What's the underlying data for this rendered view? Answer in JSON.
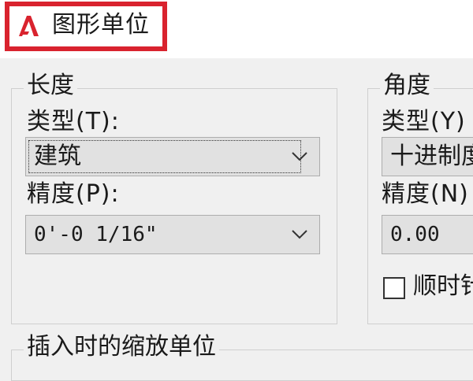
{
  "window": {
    "title": "图形单位",
    "icon": "autocad-logo-icon",
    "highlight_color": "#d9232e"
  },
  "length": {
    "group_label": "长度",
    "type_label": "类型(T):",
    "type_value": "建筑",
    "precision_label": "精度(P):",
    "precision_value": "0'-0 1/16\""
  },
  "angle": {
    "group_label": "角度",
    "type_label": "类型(Y)",
    "type_value": "十进制度",
    "precision_label": "精度(N)",
    "precision_value": "0.00",
    "clockwise_label": "顺时针",
    "clockwise_checked": false
  },
  "insert_scale": {
    "group_label": "插入时的缩放单位"
  }
}
